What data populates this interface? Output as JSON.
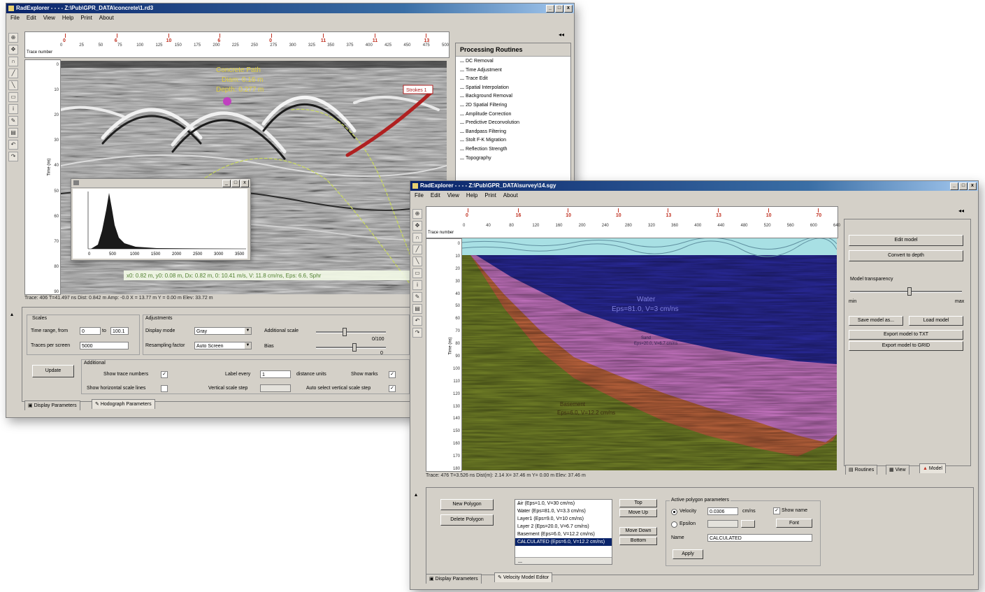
{
  "window1": {
    "title": "RadExplorer - - - - Z:\\Pub\\GPR_DATA\\concrete\\1.rd3",
    "menu": [
      "File",
      "Edit",
      "View",
      "Help",
      "Print",
      "About"
    ],
    "trace_number_label": "Trace number",
    "markers": [
      "0",
      "6",
      "10",
      "6",
      "0",
      "11",
      "11",
      "13"
    ],
    "ruler_ticks": [
      "0",
      "25",
      "50",
      "75",
      "100",
      "125",
      "150",
      "175",
      "200",
      "225",
      "250",
      "275",
      "300",
      "325",
      "350",
      "375",
      "400",
      "425",
      "450",
      "475",
      "500"
    ],
    "depth_ticks": [
      "0",
      "10",
      "20",
      "30",
      "40",
      "50",
      "60",
      "70",
      "80",
      "90"
    ],
    "time_axis_label": "Time (ns)",
    "annotation_concrete": {
      "line1": "Concrete Path",
      "line2": "Diam: 0.16 m",
      "line3": "Depth: 0.277 m"
    },
    "annotation_tag": "Strokes 1",
    "readout": "x0: 0.82 m, y0: 0.08 m, Dx: 0.82 m, 0: 10.41 m/s, V: 11.8 cm/ns, Eps: 6.6, Sphr",
    "status": "Trace: 406   T=41.497 ns   Dist: 0.842 m   Amp: -0.0   X = 13.77 m   Y = 0.00 m   Elev: 33.72 m",
    "histogram": {
      "title": "",
      "ticks": [
        "0",
        "500",
        "1000",
        "1500",
        "2000",
        "2500",
        "3000",
        "3500"
      ]
    },
    "processing": {
      "header": "Processing Routines",
      "items": [
        "DC Removal",
        "Time Adjustment",
        "Trace Edit",
        "Spatial Interpolation",
        "Background Removal",
        "2D Spatial Filtering",
        "Amplitude Correction",
        "Predictive Deconvolution",
        "Bandpass Filtering",
        "Stolt F-K Migration",
        "Reflection Strength",
        "Topography"
      ]
    },
    "params": {
      "scales_title": "Scales",
      "time_range_label": "Time range, from",
      "time_from": "0",
      "time_to_label": "to",
      "time_to": "100.1",
      "traces_per_screen_label": "Traces per screen",
      "traces_per_screen": "5000",
      "adjustments_title": "Adjustments",
      "display_mode_label": "Display mode",
      "display_mode": "Gray",
      "resampling_label": "Resampling factor",
      "resampling": "Auto Screen",
      "amplitude_label": "Additional scale",
      "bias_label": "Bias",
      "amp_value": "0/100",
      "bias_value": "0",
      "update_button": "Update",
      "additional_title": "Additional",
      "show_trace_numbers": "Show trace numbers",
      "show_horizontal_scale": "Show horizontal scale lines",
      "label_every_label": "Label every",
      "label_every": "1",
      "distance_units": "distance units",
      "vertical_step_label": "Vertical scale step",
      "show_marks": "Show marks",
      "auto_select": "Auto select vertical scale step",
      "tab_display": "Display Parameters",
      "tab_hodograph": "Hodograph Parameters"
    }
  },
  "window2": {
    "title": "RadExplorer - - - - Z:\\Pub\\GPR_DATA\\survey\\14.sgy",
    "menu": [
      "File",
      "Edit",
      "View",
      "Help",
      "Print",
      "About"
    ],
    "trace_number_label": "Trace number",
    "markers": [
      "0",
      "16",
      "10",
      "10",
      "13",
      "13",
      "10",
      "70"
    ],
    "ruler_ticks": [
      "0",
      "40",
      "80",
      "120",
      "160",
      "200",
      "240",
      "280",
      "320",
      "360",
      "400",
      "440",
      "480",
      "520",
      "560",
      "600",
      "640"
    ],
    "depth_ticks": [
      "0",
      "10",
      "20",
      "30",
      "40",
      "50",
      "60",
      "70",
      "80",
      "90",
      "100",
      "110",
      "120",
      "130",
      "140",
      "150",
      "160",
      "170",
      "180"
    ],
    "time_axis_label": "Time (ns)",
    "layer_water": {
      "name": "Water",
      "params": "Eps=81.0, V=3 cm/ns"
    },
    "layer_sand": {
      "name": "Sand",
      "params": "Eps=20.0, V=6.7 cm/ns"
    },
    "layer_basement": {
      "name": "Basement",
      "params": "Eps=6.0, V=12.2 cm/ns"
    },
    "status": "Trace: 476   T=3.526 ns   Dist(m): 2.14   X= 37.46 m   Y= 0.00 m   Elev: 37.46 m",
    "right_panel": {
      "edit_model": "Edit model",
      "convert_depth": "Convert to depth",
      "transparency_label": "Model transparency",
      "min_label": "min",
      "max_label": "max",
      "save_model": "Save model as...",
      "load_model": "Load model",
      "export_1": "Export model to TXT",
      "export_2": "Export model to GRID",
      "tabs": [
        "Routines",
        "View",
        "Model"
      ]
    },
    "model_panel": {
      "new_polygon": "New Polygon",
      "delete_polygon": "Delete Polygon",
      "polygons": [
        "Air (Eps=1.0, V=30 cm/ns)",
        "Water (Eps=81.0, V=3.3 cm/ns)",
        "Layer1 (Eps=9.0, V=10 cm/ns)",
        "Layer 2 (Eps=20.0, V=6.7 cm/ns)",
        "Basement (Eps=6.0, V=12.2 cm/ns)",
        "CALCULATED (Eps=6.0, V=12.2 cm/ns)"
      ],
      "top": "Top",
      "move_up": "Move Up",
      "move_down": "Move Down",
      "bottom": "Bottom",
      "active_title": "Active polygon parameters",
      "velocity_label": "Velocity",
      "velocity_value": "0.0306",
      "velocity_unit": "cm/ns",
      "epsilon_label": "Epsilon",
      "epsilon_value": "",
      "show_name": "Show name",
      "font_button": "Font",
      "name_label": "Name",
      "name_value": "CALCULATED",
      "apply": "Apply",
      "tab_display": "Display Parameters",
      "tab_velocity": "Velocity Model Editor"
    }
  }
}
